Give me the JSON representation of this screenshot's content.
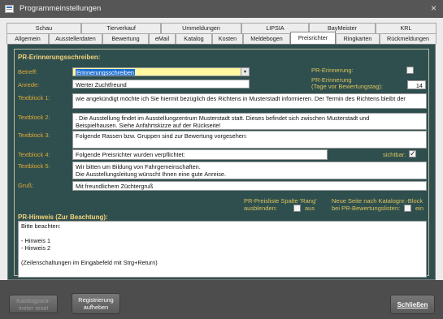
{
  "window": {
    "title": "Programmeinstellungen",
    "close_glyph": "×"
  },
  "tabs": {
    "row1": [
      "Schau",
      "Tierverkauf",
      "Ummeldungen",
      "LIPSIA",
      "BayMeister",
      "KRL"
    ],
    "row2": [
      "Allgemein",
      "Ausstellerdaten",
      "Bewertung",
      "eMail",
      "Katalog",
      "Kosten",
      "Meldebogen",
      "Preisrichter",
      "Ringkarten",
      "Rückmeldungen"
    ],
    "active": "Preisrichter"
  },
  "section": {
    "heading": "PR-Erinnerungsschreiben:"
  },
  "fields": {
    "betreff_label": "Betreff:",
    "betreff_value": "Erinnerungsschreiben",
    "anrede_label": "Anrede:",
    "anrede_value": "Werter Zuchtfreund",
    "tb1_label": "Textblock 1:",
    "tb1_value": "wie angekündigt möchte ich Sie hiermit bezüglich des Richtens in Musterstadt informieren. Der Termin des Richtens bleibt der",
    "tb2_label": "Textblock 2:",
    "tb2_value": ". Die Ausstellung findet im Ausstellungzentrum Musterstadt statt. Dieses befindet sich zwischen Musterstadt und\nBeispielhausen. Siehe Anfahrtskizze auf der Rückseite!",
    "tb3_label": "Textblock 3:",
    "tb3_value": "Folgende Rassen bzw. Gruppen sind zur Bewertung vorgesehen:",
    "tb4_label": "Textblock 4:",
    "tb4_value": "Folgende Preisrichter wurden verpflichtet:",
    "tb5_label": "Textblock 5:",
    "tb5_value": "Wir bitten um Bildung von Fahrgemeinschaften.\nDie Ausstellungsleitung wünscht Ihnen eine gute Anreise.",
    "gruss_label": "Gruß:",
    "gruss_value": "Mit freundlichem Züchtergruß"
  },
  "right": {
    "pr_erinnerung_label": "PR-Erinnerung:",
    "pr_erinnerung_checked": false,
    "tage_label_1": "PR-Erinnerung",
    "tage_label_2": "(Tage vor Bewertungstag):",
    "tage_value": "14",
    "sichtbar_label": "sichtbar:",
    "sichtbar_checked": true
  },
  "options": {
    "spalte_label_1": "PR-Preisliste Spalte 'Rang'",
    "spalte_label_2": "ausblenden:",
    "spalte_aus": "aus",
    "spalte_checked": false,
    "seite_label_1": "Neue Seite nach Katalognr.-Block",
    "seite_label_2": "bei PR-Bewertungslisten:",
    "seite_ein": "ein",
    "seite_checked": false
  },
  "hinweis": {
    "heading": "PR-Hinweis (Zur Beachtung):",
    "text": "Bitte beachten:\n\n- Hinweis 1\n- Hinweis 2\n\n(Zeilenschaltungen im Eingabefeld mit Strg+Return)"
  },
  "footer": {
    "katalog_btn": "Katalogpara-\nmeter reset",
    "registrierung_btn": "Registrierung\naufheben",
    "schliessen_btn": "Schließen"
  },
  "colors": {
    "panel": "#2f4f4f",
    "label": "#e0a832",
    "heading": "#f3d37a",
    "highlight": "#fff8a0",
    "selection": "#1e6fd2"
  }
}
